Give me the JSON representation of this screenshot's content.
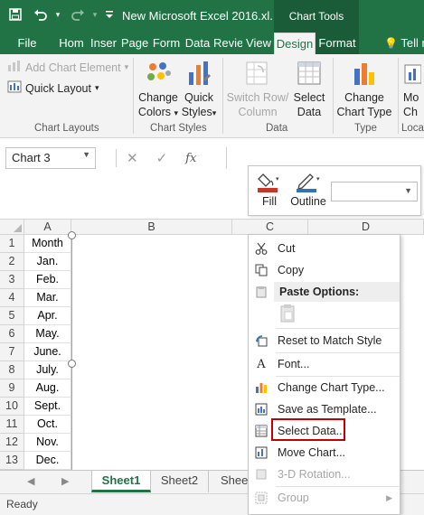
{
  "titlebar": {
    "doc_title": "New Microsoft Excel 2016.xl...",
    "chart_tools": "Chart Tools"
  },
  "tabs": [
    {
      "label": "File"
    },
    {
      "label": "Hom"
    },
    {
      "label": "Inser"
    },
    {
      "label": "Page"
    },
    {
      "label": "Form"
    },
    {
      "label": "Data"
    },
    {
      "label": "Revie"
    },
    {
      "label": "View"
    },
    {
      "label": "Design"
    },
    {
      "label": "Format"
    }
  ],
  "tell_me": "Tell me",
  "ribbon": {
    "add_chart_element": "Add Chart Element",
    "quick_layout": "Quick Layout",
    "chart_layouts_label": "Chart Layouts",
    "change_colors_1": "Change",
    "change_colors_2": "Colors",
    "quick_styles_1": "Quick",
    "quick_styles_2": "Styles",
    "chart_styles_label": "Chart Styles",
    "switch_row_1": "Switch Row/",
    "switch_row_2": "Column",
    "select_data_1": "Select",
    "select_data_2": "Data",
    "data_label": "Data",
    "change_type_1": "Change",
    "change_type_2": "Chart Type",
    "type_label": "Type",
    "move_1": "Mo",
    "move_2": "Ch",
    "location_label": "Loca"
  },
  "namebox": "Chart 3",
  "fx": "fx",
  "minibar": {
    "fill": "Fill",
    "outline": "Outline",
    "fill_color": "#c0392b",
    "outline_color": "#2e75b6"
  },
  "columns": [
    "A",
    "B",
    "C",
    "D"
  ],
  "rows": [
    {
      "n": "1",
      "a": "Month"
    },
    {
      "n": "2",
      "a": "Jan."
    },
    {
      "n": "3",
      "a": "Feb."
    },
    {
      "n": "4",
      "a": "Mar."
    },
    {
      "n": "5",
      "a": "Apr."
    },
    {
      "n": "6",
      "a": "May."
    },
    {
      "n": "7",
      "a": "June."
    },
    {
      "n": "8",
      "a": "July."
    },
    {
      "n": "9",
      "a": "Aug."
    },
    {
      "n": "10",
      "a": "Sept."
    },
    {
      "n": "11",
      "a": "Oct."
    },
    {
      "n": "12",
      "a": "Nov."
    },
    {
      "n": "13",
      "a": "Dec."
    }
  ],
  "sheets": [
    "Sheet1",
    "Sheet2",
    "Sheet"
  ],
  "status": "Ready",
  "context_menu": {
    "cut": "Cut",
    "copy": "Copy",
    "paste_options": "Paste Options:",
    "reset_style": "Reset to Match Style",
    "font": "Font...",
    "change_chart_type": "Change Chart Type...",
    "save_template": "Save as Template...",
    "select_data": "Select Data...",
    "move_chart": "Move Chart...",
    "rotation": "3-D Rotation...",
    "group": "Group"
  },
  "colors": {
    "excel_green": "#217346",
    "highlight_red": "#c00000"
  }
}
